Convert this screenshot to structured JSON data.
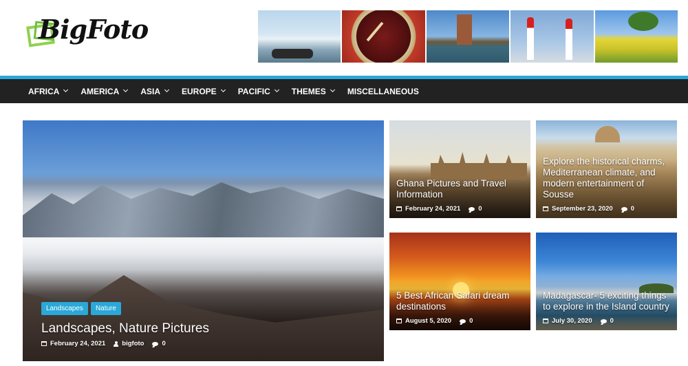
{
  "site": {
    "logo_text": "BigFoto"
  },
  "banner": {
    "icons": [
      "iceberg-photo",
      "clock-photo",
      "bridge-photo",
      "airrace-photo",
      "field-photo"
    ]
  },
  "nav": {
    "items": [
      {
        "label": "AFRICA",
        "dropdown": true
      },
      {
        "label": "AMERICA",
        "dropdown": true
      },
      {
        "label": "ASIA",
        "dropdown": true
      },
      {
        "label": "EUROPE",
        "dropdown": true
      },
      {
        "label": "PACIFIC",
        "dropdown": true
      },
      {
        "label": "THEMES",
        "dropdown": true
      },
      {
        "label": "MISCELLANEOUS",
        "dropdown": false
      }
    ]
  },
  "featured": {
    "main": {
      "tags": [
        "Landscapes",
        "Nature"
      ],
      "title": "Landscapes, Nature Pictures",
      "date": "February 24, 2021",
      "author": "bigfoto",
      "comments": "0"
    },
    "posts": [
      {
        "title": "Ghana Pictures and Travel Information",
        "date": "February 24, 2021",
        "comments": "0"
      },
      {
        "title": "Explore the historical charms, Mediterranean climate, and modern entertainment of Sousse",
        "date": "September 23, 2020",
        "comments": "0"
      },
      {
        "title": "5 Best African Safari dream destinations",
        "date": "August 5, 2020",
        "comments": "0"
      },
      {
        "title": "Madagascar- 5 exciting things to explore in the Island country",
        "date": "July 30, 2020",
        "comments": "0"
      }
    ]
  },
  "colors": {
    "accent": "#2aa8d8",
    "nav_bg": "#222222"
  }
}
